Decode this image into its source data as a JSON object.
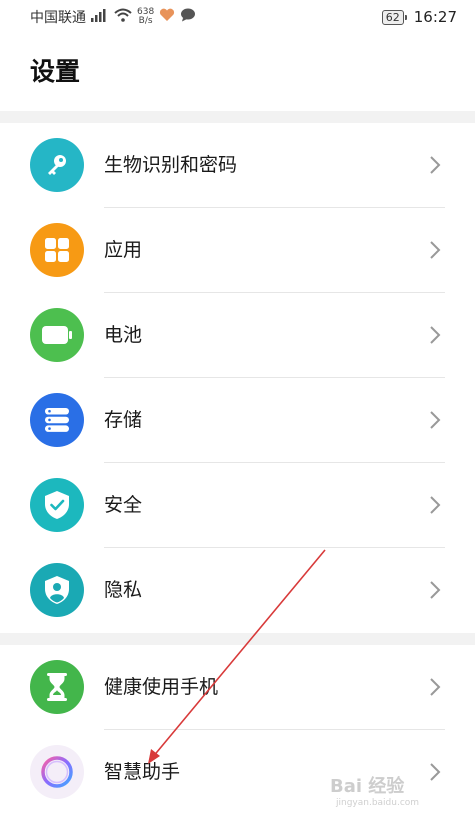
{
  "status_bar": {
    "carrier": "中国联通",
    "network_gen": "4G",
    "speed_value": "638",
    "speed_unit": "B/s",
    "battery": "62",
    "time": "16:27"
  },
  "page": {
    "title": "设置"
  },
  "groups": [
    {
      "items": [
        {
          "label": "生物识别和密码",
          "icon": "key-icon",
          "color": "#25b6c6"
        },
        {
          "label": "应用",
          "icon": "apps-grid-icon",
          "color": "#f79a14"
        },
        {
          "label": "电池",
          "icon": "battery-icon",
          "color": "#4dbf4f"
        },
        {
          "label": "存储",
          "icon": "storage-icon",
          "color": "#2a6fe6"
        },
        {
          "label": "安全",
          "icon": "shield-check-icon",
          "color": "#1cb8be"
        },
        {
          "label": "隐私",
          "icon": "privacy-shield-icon",
          "color": "#1aa9b4"
        }
      ]
    },
    {
      "items": [
        {
          "label": "健康使用手机",
          "icon": "hourglass-icon",
          "color": "#43b64b"
        },
        {
          "label": "智慧助手",
          "icon": "assistant-ring-icon",
          "color": "#f4eef8"
        }
      ]
    }
  ],
  "watermark": {
    "text": "Bai 经验",
    "subtext": "jingyan.baidu.com"
  }
}
